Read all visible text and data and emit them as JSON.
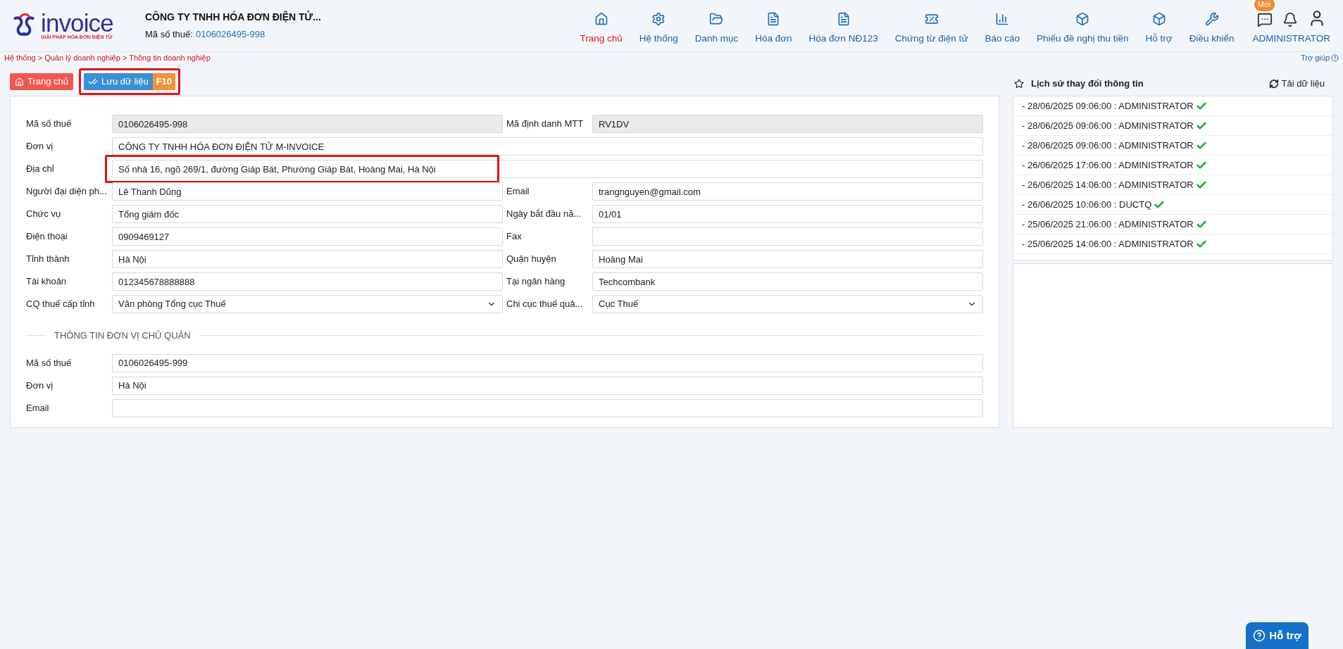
{
  "logo": {
    "name": "invoice",
    "tagline": "GIẢI PHÁP HÓA ĐƠN ĐIỆN TỬ"
  },
  "company": {
    "name": "CÔNG TY TNHH HÓA ĐƠN ĐIỆN TỬ...",
    "tax_label": "Mã số thuế:",
    "tax_code": "0106026495-998"
  },
  "nav": [
    {
      "label": "Trang chủ",
      "selected": true
    },
    {
      "label": "Hệ thống",
      "selected": false
    },
    {
      "label": "Danh mục",
      "selected": false
    },
    {
      "label": "Hóa đơn",
      "selected": false
    },
    {
      "label": "Hóa đơn NĐ123",
      "selected": false
    },
    {
      "label": "Chứng từ điện tử",
      "selected": false
    },
    {
      "label": "Báo cáo",
      "selected": false
    },
    {
      "label": "Phiếu đề nghị thu tiền",
      "selected": false
    },
    {
      "label": "Hỗ trợ",
      "selected": false
    },
    {
      "label": "Điều khiển",
      "selected": false
    }
  ],
  "user_area": {
    "badge": "Mới",
    "user": "ADMINISTRATOR"
  },
  "breadcrumb": "Hệ thống > Quản lý doanh nghiệp > Thông tin doanh nghiệp",
  "help_link": "Trợ giúp",
  "toolbar": [
    {
      "kind": "home",
      "label": "Trang chủ",
      "highlighted": false
    },
    {
      "kind": "save",
      "label": "Lưu dữ liệu",
      "shortcut": "F10",
      "highlighted": true
    }
  ],
  "form": {
    "rows": [
      [
        {
          "label": "Mã số thuế",
          "value": "0106026495-998",
          "kind": "readonly"
        },
        {
          "label": "Mã định danh MTT",
          "value": "RV1DV",
          "kind": "readonly"
        }
      ],
      [
        {
          "label": "Đơn vị",
          "value": "CÔNG TY TNHH HÓA ĐƠN ĐIỆN TỬ M-INVOICE",
          "kind": "text"
        }
      ],
      [
        {
          "label": "Địa chỉ",
          "value": "Số nhà 16, ngõ 269/1, đường Giáp Bát, Phường Giáp Bát, Hoàng Mai, Hà Nội",
          "kind": "text",
          "highlighted": true
        }
      ],
      [
        {
          "label": "Người đại diện ph...",
          "value": "Lê Thanh Dũng",
          "kind": "text"
        },
        {
          "label": "Email",
          "value": "trangnguyen@gmail.com",
          "kind": "text"
        }
      ],
      [
        {
          "label": "Chức vụ",
          "value": "Tổng giám đốc",
          "kind": "text"
        },
        {
          "label": "Ngày bắt đầu nă...",
          "value": "01/01",
          "kind": "text"
        }
      ],
      [
        {
          "label": "Điện thoại",
          "value": "0909469127",
          "kind": "text"
        },
        {
          "label": "Fax",
          "kind": "text"
        }
      ],
      [
        {
          "label": "Tỉnh thành",
          "value": "Hà Nội",
          "kind": "text"
        },
        {
          "label": "Quận huyện",
          "value": "Hoàng Mai",
          "kind": "text"
        }
      ],
      [
        {
          "label": "Tài khoản",
          "value": "012345678888888",
          "kind": "text"
        },
        {
          "label": "Tại ngân hàng",
          "value": "Techcombank",
          "kind": "text"
        }
      ],
      [
        {
          "label": "CQ thuế cấp tỉnh",
          "value": "Văn phòng Tổng cục Thuế",
          "kind": "select"
        },
        {
          "label": "Chi cục thuế quả...",
          "value": "Cục Thuế",
          "kind": "select"
        }
      ]
    ],
    "section_title": "THÔNG TIN ĐƠN VỊ CHỦ QUẢN",
    "parent_rows": [
      [
        {
          "label": "Mã số thuế",
          "value": "0106026495-999",
          "kind": "text"
        }
      ],
      [
        {
          "label": "Đơn vị",
          "value": "Hà Nội",
          "kind": "text"
        }
      ],
      [
        {
          "label": "Email",
          "kind": "text"
        }
      ]
    ]
  },
  "history": {
    "title": "Lịch sử thay đổi thông tin",
    "reload": "Tải dữ liệu",
    "items": [
      "- 28/06/2025 09:06:00 : ADMINISTRATOR",
      "- 28/06/2025 09:06:00 : ADMINISTRATOR",
      "- 28/06/2025 09:06:00 : ADMINISTRATOR",
      "- 26/06/2025 17:06:00 : ADMINISTRATOR",
      "- 26/06/2025 14:06:00 : ADMINISTRATOR",
      "- 26/06/2025 10:06:00 : DUCTQ",
      "- 25/06/2025 21:06:00 : ADMINISTRATOR",
      "- 25/06/2025 14:06:00 : ADMINISTRATOR"
    ]
  },
  "support_button": "Hỗ trợ"
}
